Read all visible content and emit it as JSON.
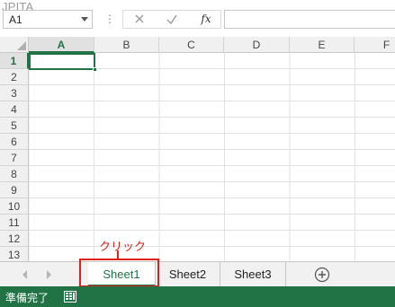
{
  "watermark": "JPITA",
  "formula_bar": {
    "name_box_value": "A1",
    "separator": "⋮",
    "cancel_icon": "close-icon",
    "enter_icon": "check-icon",
    "fx_label": "fx",
    "formula_value": ""
  },
  "grid": {
    "columns": [
      "A",
      "B",
      "C",
      "D",
      "E",
      "F"
    ],
    "rows": [
      "1",
      "2",
      "3",
      "4",
      "5",
      "6",
      "7",
      "8",
      "9",
      "10",
      "11",
      "12",
      "13"
    ],
    "active_column": "A",
    "active_row": "1",
    "active_cell": "A1"
  },
  "sheet_tabs": {
    "tabs": [
      "Sheet1",
      "Sheet2",
      "Sheet3"
    ],
    "active": "Sheet1",
    "add_icon": "plus-circle-icon"
  },
  "annotation": {
    "label": "クリック",
    "color": "#e0201b"
  },
  "status_bar": {
    "text": "準備完了",
    "icon": "cell-mode-icon"
  },
  "colors": {
    "accent": "#217346",
    "status_bg": "#217346"
  }
}
